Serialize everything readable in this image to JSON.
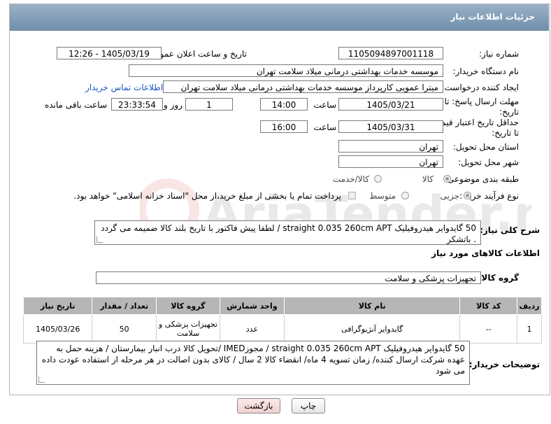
{
  "header": {
    "title": "جزئیات اطلاعات نیاز"
  },
  "fields": {
    "need_number_label": "شماره نیاز:",
    "need_number": "1105094897001118",
    "announce_label": "تاریخ و ساعت اعلان عمومی:",
    "announce_value": "1405/03/19 - 12:26",
    "buyer_org_label": "نام دستگاه خریدار:",
    "buyer_org": "موسسه خدمات بهداشتی درمانی میلاد سلامت تهران",
    "creator_label": "ایجاد کننده درخواست:",
    "creator": "میترا عمویی کارپرداز موسسه خدمات بهداشتی درمانی میلاد سلامت تهران",
    "contact_link": "اطلاعات تماس خریدار",
    "deadline_label_1": "مهلت ارسال پاسخ: تا",
    "deadline_label_2": "تاریخ:",
    "deadline_date": "1405/03/21",
    "time_label": "ساعت",
    "deadline_time": "14:00",
    "days_value": "1",
    "days_label": "روز و",
    "remaining_time": "23:33:54",
    "remaining_label": "ساعت باقی مانده",
    "validity_label_1": "حداقل تاریخ اعتبار قیمت:",
    "validity_label_2": "تا تاریخ:",
    "validity_date": "1405/03/31",
    "validity_time_label": "ساعت",
    "validity_time": "16:00",
    "province_label": "استان محل تحویل:",
    "province": "تهران",
    "city_label": "شهر محل تحویل:",
    "city": "تهران",
    "category_label": "طبقه بندی موضوعی:",
    "category_goods": "کالا",
    "category_goods_service": "کالا/خدمت",
    "process_label": "نوع فرآیند خرید :",
    "process_partial": "جزیی",
    "process_medium": "متوسط",
    "payment_note": "پرداخت تمام یا بخشی از مبلغ خرید،از محل \"اسناد خزانه اسلامی\" خواهد بود.",
    "description_label": "شرح کلی نیاز:",
    "description": "50 گایدوایر هیدروفیلیک straight 0.035 260cm APT / لطفا پیش فاکتور با تاریخ بلند کالا ضمیمه می گردد . باتشکر"
  },
  "goods_section": {
    "title": "اطلاعات کالاهای مورد نیاز",
    "group_label": "گروه کالا:",
    "group_value": "تجهیزات پزشکی و سلامت"
  },
  "table": {
    "headers": [
      "ردیف",
      "کد کالا",
      "نام کالا",
      "واحد شمارش",
      "گروه کالا",
      "تعداد / مقدار",
      "تاریخ نیاز"
    ],
    "rows": [
      {
        "row": "1",
        "code": "--",
        "name": "گایدوایر آنژیوگرافی",
        "unit": "عدد",
        "group": "تجهیزات پزشکی و سلامت",
        "qty": "50",
        "date": "1405/03/26"
      }
    ]
  },
  "buyer_notes": {
    "label": "توضیحات خریدار:",
    "text": "50 گایدوایر هیدروفیلیک straight 0.035 260cm APT / مجوزIMED /تحویل کالا درب انبار بیمارستان / هزینه حمل به عهده شرکت ارسال کننده/ زمان تسویه 4 ماه/ انقضاء کالا 2 سال / کالای بدون اصالت در هر مرحله از استفاده عودت داده می شود"
  },
  "buttons": {
    "print": "چاپ",
    "back": "بازگشت"
  },
  "watermark_text": "AriaTender.neT",
  "colors": {
    "header": "#7f9bb6",
    "link": "#1a56c4",
    "table_header": "#b6b6b6",
    "back_button": "#f7dede"
  }
}
